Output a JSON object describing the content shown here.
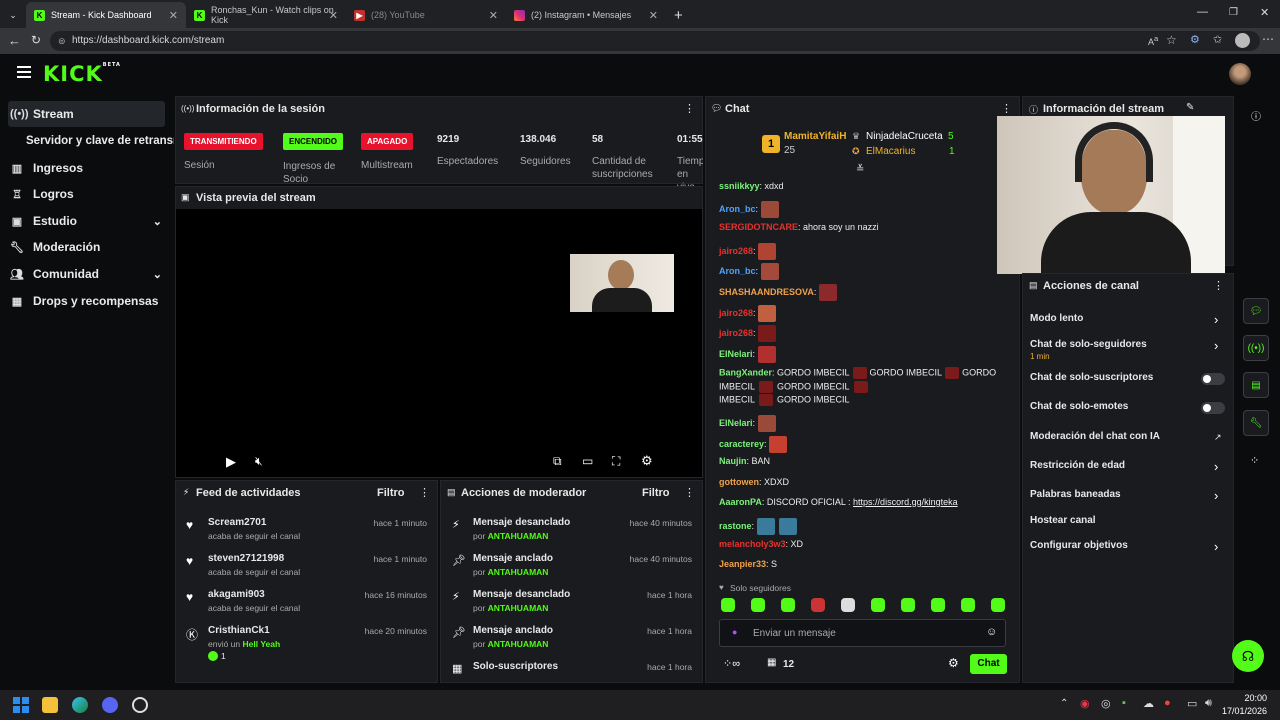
{
  "browser": {
    "tabs": [
      {
        "title": "Stream - Kick Dashboard",
        "active": true
      },
      {
        "title": "Ronchas_Kun - Watch clips on Kick",
        "active": false
      },
      {
        "title": "(28) YouTube",
        "active": false
      },
      {
        "title": "(2) Instagram • Mensajes",
        "active": false
      }
    ],
    "url": "https://dashboard.kick.com/stream",
    "new_tab": "+"
  },
  "brand": {
    "logo": "KICK",
    "beta": "BETA",
    "accent": "#53fc18"
  },
  "sidebar": {
    "items": [
      {
        "label": "Stream",
        "icon": "broadcast-icon"
      },
      {
        "label": "Servidor y clave de retransmisión",
        "icon": ""
      },
      {
        "label": "Ingresos",
        "icon": "chart-icon"
      },
      {
        "label": "Logros",
        "icon": "trophy-icon"
      },
      {
        "label": "Estudio",
        "icon": "camera-icon"
      },
      {
        "label": "Moderación",
        "icon": "wrench-icon"
      },
      {
        "label": "Comunidad",
        "icon": "people-icon"
      },
      {
        "label": "Drops y recompensas",
        "icon": "gift-icon"
      }
    ]
  },
  "session": {
    "title": "Información de la sesión",
    "badges": [
      {
        "text": "TRANSMITIENDO",
        "label": "Sesión",
        "color": "#e8122d"
      },
      {
        "text": "ENCENDIDO",
        "label": "Ingresos de Socio",
        "color": "#53fc18"
      },
      {
        "text": "APAGADO",
        "label": "Multistream",
        "color": "#e8122d"
      }
    ],
    "stats": [
      {
        "value": "9219",
        "label": "Espectadores"
      },
      {
        "value": "138.046",
        "label": "Seguidores"
      },
      {
        "value": "58",
        "label": "Cantidad de suscripciones"
      },
      {
        "value": "01:55",
        "label": "Tiempo en vivo"
      }
    ]
  },
  "preview": {
    "title": "Vista previa del stream"
  },
  "activity": {
    "title": "Feed de actividades",
    "filter": "Filtro",
    "items": [
      {
        "user": "Scream2701",
        "desc": "acaba de seguir el canal",
        "time": "hace 1 minuto",
        "icon": "heart-icon"
      },
      {
        "user": "steven27121998",
        "desc": "acaba de seguir el canal",
        "time": "hace 1 minuto",
        "icon": "heart-icon"
      },
      {
        "user": "akagami903",
        "desc": "acaba de seguir el canal",
        "time": "hace 16 minutos",
        "icon": "heart-icon"
      },
      {
        "user": "CristhianCk1",
        "desc": "envió un",
        "highlight": "Hell Yeah",
        "count": "1",
        "time": "hace 20 minutos",
        "icon": "kick-icon"
      }
    ]
  },
  "modactions": {
    "title": "Acciones de moderador",
    "filter": "Filtro",
    "items": [
      {
        "action": "Mensaje desanclado",
        "by": "por",
        "mod": "ANTAHUAMAN",
        "time": "hace 40 minutos",
        "icon": "unpin-icon"
      },
      {
        "action": "Mensaje anclado",
        "by": "por",
        "mod": "ANTAHUAMAN",
        "time": "hace 40 minutos",
        "icon": "pin-icon"
      },
      {
        "action": "Mensaje desanclado",
        "by": "por",
        "mod": "ANTAHUAMAN",
        "time": "hace 1 hora",
        "icon": "unpin-icon"
      },
      {
        "action": "Mensaje anclado",
        "by": "por",
        "mod": "ANTAHUAMAN",
        "time": "hace 1 hora",
        "icon": "pin-icon"
      },
      {
        "action": "Solo-suscriptores",
        "by": "",
        "mod": "",
        "time": "hace 1 hora",
        "icon": "gift-icon"
      }
    ]
  },
  "chat": {
    "title": "Chat",
    "leader": {
      "name": "MamitaYifaiH",
      "count": "25"
    },
    "top": [
      {
        "name": "NinjadelaCruceta",
        "count": "5"
      },
      {
        "name": "ElMacarius",
        "count": "1"
      }
    ],
    "messages": [
      {
        "user": "ssniikkyy",
        "color": "#7cf27a",
        "text": "xdxd"
      },
      {
        "user": "Aron_bc",
        "color": "#4da3ff",
        "text": ""
      },
      {
        "user": "SERGIDOTNCARE",
        "color": "#e8312d",
        "text": "ahora soy un nazzi"
      },
      {
        "user": "jairo268",
        "color": "#e8312d",
        "text": ""
      },
      {
        "user": "Aron_bc",
        "color": "#4da3ff",
        "text": ""
      },
      {
        "user": "SHASHAANDRESOVA",
        "color": "#f0a24a",
        "text": ""
      },
      {
        "user": "jairo268",
        "color": "#e8312d",
        "text": ""
      },
      {
        "user": "jairo268",
        "color": "#e8312d",
        "text": ""
      },
      {
        "user": "ElNelari",
        "color": "#7cf27a",
        "text": ""
      },
      {
        "user": "BangXander",
        "color": "#7cf27a",
        "text": "GORDO IMBECIL",
        "line2": "IMBECIL",
        "line2b": "GORDO IMBECIL",
        "line2c": "GORDO IMBECIL",
        "line2d": "GORDO",
        "line3": "IMBECIL",
        "line3b": "GORDO IMBECIL"
      },
      {
        "user": "ElNelari",
        "color": "#7cf27a",
        "text": ""
      },
      {
        "user": "caracterey",
        "color": "#7cf27a",
        "text": ""
      },
      {
        "user": "Naujin",
        "color": "#7cf27a",
        "text": "BAN"
      },
      {
        "user": "gottowen",
        "color": "#f0a24a",
        "text": "XDXD"
      },
      {
        "user": "AaaronPA",
        "color": "#7cf27a",
        "text": "DISCORD OFICIAL : ",
        "link": "https://discord.gg/kingteka"
      },
      {
        "user": "rastone",
        "color": "#7cf27a",
        "text": ""
      },
      {
        "user": "melancholy3w3",
        "color": "#e8312d",
        "text": "XD"
      },
      {
        "user": "Jeanpier33",
        "color": "#f0a24a",
        "text": "S"
      }
    ],
    "mode": "Solo seguidores",
    "placeholder": "Enviar un mensaje",
    "infinity": "∞",
    "gift_count": "12",
    "send": "Chat"
  },
  "streaminfo": {
    "title": "Información del stream"
  },
  "channel_actions": {
    "title": "Acciones de canal",
    "items": [
      {
        "label": "Modo lento",
        "control": "arrow"
      },
      {
        "label": "Chat de solo-seguidores",
        "sub": "1 min",
        "control": "arrow"
      },
      {
        "label": "Chat de solo-suscriptores",
        "control": "toggle"
      },
      {
        "label": "Chat de solo-emotes",
        "control": "toggle"
      },
      {
        "label": "Moderación del chat con IA",
        "control": "external"
      },
      {
        "label": "Restricción de edad",
        "control": "arrow"
      },
      {
        "label": "Palabras baneadas",
        "control": "arrow"
      },
      {
        "label": "Hostear canal",
        "control": "none"
      },
      {
        "label": "Configurar objetivos",
        "control": "arrow"
      }
    ]
  },
  "taskbar": {
    "time": "20:00",
    "date": "17/01/2026"
  }
}
